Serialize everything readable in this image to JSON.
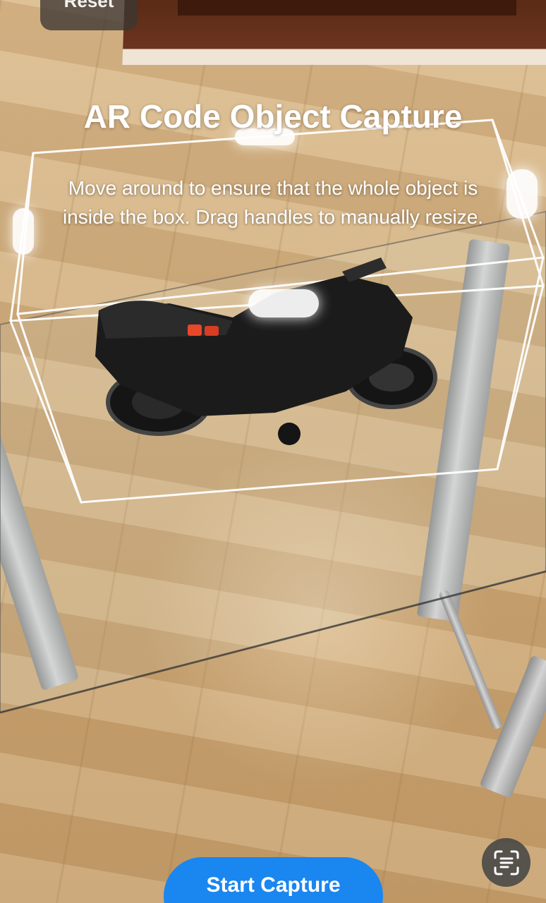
{
  "toolbar": {
    "reset_label": "Reset"
  },
  "header": {
    "title": "AR Code Object Capture",
    "instructions": "Move around to ensure that the whole object is inside the box. Drag handles to manually resize."
  },
  "footer": {
    "start_label": "Start Capture",
    "scan_icon": "text-scan-icon"
  },
  "colors": {
    "accent": "#1a86f0",
    "bounding_box": "#ffffff",
    "floating_button": "#3c3732"
  },
  "icons": [
    "text-scan-icon",
    "resize-handle"
  ]
}
